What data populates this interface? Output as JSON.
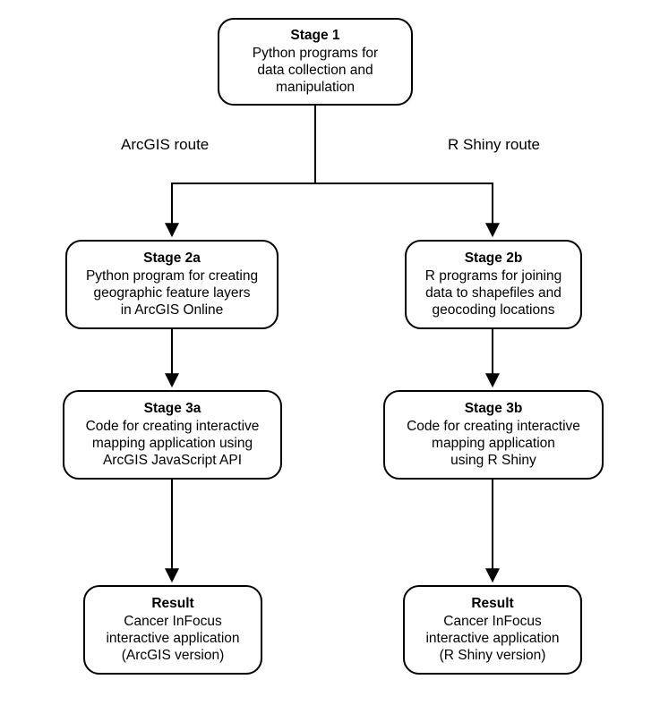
{
  "stage1": {
    "title": "Stage 1",
    "text": "Python programs for\ndata collection and\nmanipulation"
  },
  "routeLeftLabel": "ArcGIS route",
  "routeRightLabel": "R Shiny route",
  "stage2a": {
    "title": "Stage 2a",
    "text": "Python program for creating\ngeographic feature layers\nin ArcGIS Online"
  },
  "stage2b": {
    "title": "Stage 2b",
    "text": "R programs for joining\ndata to shapefiles and\ngeocoding locations"
  },
  "stage3a": {
    "title": "Stage 3a",
    "text": "Code for creating interactive\nmapping application using\nArcGIS JavaScript API"
  },
  "stage3b": {
    "title": "Stage 3b",
    "text": "Code for creating interactive\nmapping application\nusing R Shiny"
  },
  "resultA": {
    "title": "Result",
    "text": "Cancer InFocus\ninteractive application\n(ArcGIS version)"
  },
  "resultB": {
    "title": "Result",
    "text": "Cancer InFocus\ninteractive application\n(R Shiny version)"
  }
}
